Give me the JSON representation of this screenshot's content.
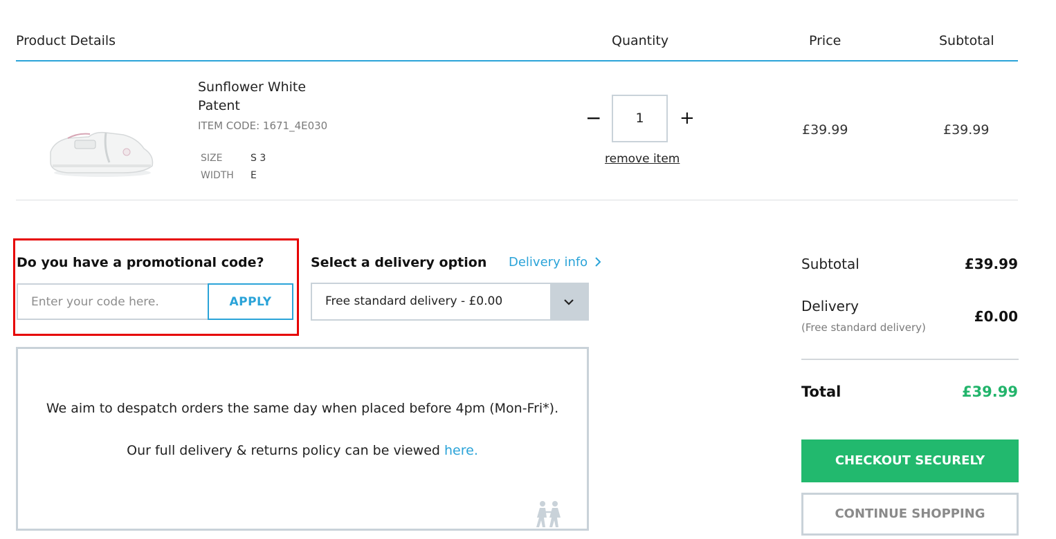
{
  "table_header": {
    "product_details": "Product Details",
    "quantity": "Quantity",
    "price": "Price",
    "subtotal": "Subtotal"
  },
  "product": {
    "name": "Sunflower White Patent",
    "item_code": "ITEM CODE: 1671_4E030",
    "size_label": "SIZE",
    "size_value": "S 3",
    "width_label": "WIDTH",
    "width_value": "E",
    "quantity": "1",
    "minus_symbol": "−",
    "plus_symbol": "+",
    "remove_label": "remove item",
    "price": "£39.99",
    "subtotal": "£39.99",
    "image_icon": "shoe-image"
  },
  "promo": {
    "title": "Do you have a promotional code?",
    "placeholder": "Enter your code here.",
    "apply_label": "APPLY"
  },
  "delivery": {
    "title": "Select a delivery option",
    "info_link": "Delivery info",
    "selected_option": "Free standard delivery - £0.00",
    "note_line1": "We aim to despatch orders the same day when placed before 4pm (Mon-Fri*).",
    "note_line2_prefix": "Our full delivery & returns policy can be viewed ",
    "note_line2_link": "here."
  },
  "summary": {
    "subtotal_label": "Subtotal",
    "subtotal_value": "£39.99",
    "delivery_label": "Delivery",
    "delivery_sub": "(Free standard delivery)",
    "delivery_value": "£0.00",
    "total_label": "Total",
    "total_value": "£39.99",
    "checkout_label": "CHECKOUT SECURELY",
    "continue_label": "CONTINUE SHOPPING"
  },
  "colors": {
    "accent_blue": "#2aa3d8",
    "checkout_green": "#22b96e",
    "highlight_red": "#e60000",
    "border_grey": "#c9d2d9"
  }
}
